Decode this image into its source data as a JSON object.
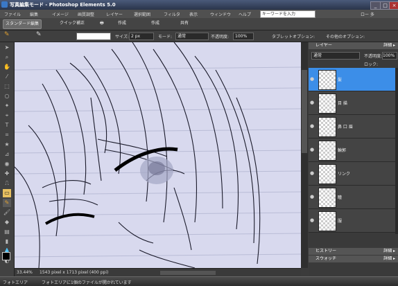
{
  "window": {
    "title": "写真編集モード - Photoshop Elements 5.0",
    "minimize": "_",
    "maximize": "□",
    "close": "×"
  },
  "menu": {
    "items": [
      "ファイル",
      "編集",
      "イメージ",
      "画質調整",
      "レイヤー",
      "選択範囲",
      "フィルタ",
      "表示",
      "ウィンドウ",
      "ヘルプ"
    ],
    "search_placeholder": "キーワードを入力",
    "right_label": "ロー 多"
  },
  "modebar": {
    "tabs": [
      "スタンダード編集",
      "クイック補正"
    ],
    "buttons": [
      "印刷",
      "作成",
      "共有"
    ]
  },
  "options": {
    "size_label": "サイズ:",
    "size_value": "2 px",
    "mode_label": "モード:",
    "mode_value": "通常",
    "opacity_label": "不透明度:",
    "opacity_value": "100%",
    "tablet_label": "タブレットオプション:",
    "other_label": "その他のオプション:"
  },
  "layers_panel": {
    "title": "レイヤー",
    "detail": "詳細 ▸",
    "blend_mode": "通常",
    "opacity_label": "不透明度:",
    "opacity_value": "100%",
    "lock_label": "ロック:",
    "layers": [
      {
        "name": "髪",
        "selected": true
      },
      {
        "name": "目 描",
        "selected": false
      },
      {
        "name": "鼻 口 眉",
        "selected": false
      },
      {
        "name": "輪郭",
        "selected": false
      },
      {
        "name": "リンク",
        "selected": false
      },
      {
        "name": "瞳",
        "selected": false
      },
      {
        "name": "服",
        "selected": false
      }
    ]
  },
  "collapsed_panels": [
    {
      "title": "ヒストリー",
      "detail": "詳細 ▸"
    },
    {
      "title": "スウォッチ",
      "detail": "詳細 ▸"
    }
  ],
  "status": {
    "zoom": "33.44%",
    "dimensions": "1543 pixel x 1713 pixel (400 ppi)"
  },
  "taskbar": {
    "bin": "フォトエリア",
    "hint": "フォトエリアに1個のファイルが開かれています"
  },
  "colors": {
    "accent": "#3c8ee8",
    "canvas": "#d8d9ee"
  }
}
